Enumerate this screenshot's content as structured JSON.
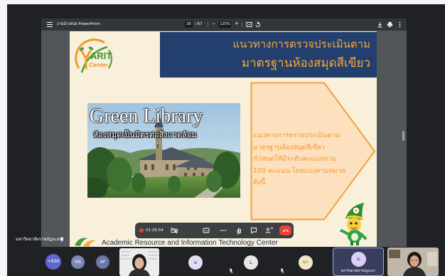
{
  "meeting": {
    "presenter_label": "มหาวิทยาลัยราชภัฏยะลา"
  },
  "pdf_viewer": {
    "title": "งานนำเสนอ PowerPoint",
    "page_current": "30",
    "page_total": "/ 67",
    "zoom_out": "—",
    "zoom": "125%",
    "zoom_in": "+",
    "icons": [
      "menu-icon",
      "fit-page-icon",
      "rotate-icon",
      "download-icon",
      "print-icon",
      "more-vert-icon"
    ]
  },
  "slide": {
    "logo": {
      "name": "ARIT",
      "sub": "Center"
    },
    "heading": [
      "แนวทางการตรวจประเมินตาม",
      "มาตรฐานห้องสมุดสีเขียว"
    ],
    "image_title": "Green Library",
    "image_subtitle": "ห้องสมุดเป็นมิตรต่อสิ่งแวดล้อม",
    "arrow_text": [
      "แนวทางการตรวจประเมินตาม",
      "มาตรฐานห้องสมุดสีเขียว",
      "กำหนดให้มีระดับคะแนนรวม",
      "100 คะแนน โดยแบ่งตามหมวด",
      "ดังนี้"
    ],
    "footer": "Academic Resource and Information Technology Center"
  },
  "call_controls": {
    "timer": "01:25:54",
    "icons": [
      "record-icon",
      "camera-off-icon",
      "captions-icon",
      "more-horiz-icon",
      "raise-hand-icon",
      "chat-icon",
      "participants-icon",
      "hang-up-icon"
    ]
  },
  "participants": [
    {
      "initials": "+836",
      "color": "#5f67d0",
      "text_color": "#ffffff"
    },
    {
      "initials": "KN",
      "color": "#7a88b3",
      "text_color": "#ffffff"
    },
    {
      "initials": "AP",
      "color": "#6a77a8",
      "text_color": "#ffffff"
    },
    {
      "initials": "ม",
      "color": "#e4dcf5",
      "text_color": "#3c3f86"
    },
    {
      "initials": "L",
      "color": "#e8e8e8",
      "text_color": "#3c4043"
    },
    {
      "initials": "มา",
      "color": "#f3e6c2",
      "text_color": "#6b5316"
    }
  ],
  "active_speaker": {
    "initials": "ม",
    "name": "มหาวิทยาลัยราชภัฏยะลา",
    "color": "#d9d0f5",
    "text_color": "#3c3f86"
  },
  "colors": {
    "slide_bg": "#f8f0da",
    "heading_bg": "#233f6e",
    "heading_text": "#f6a73c",
    "arrow_fill": "#fde0bd",
    "arrow_stroke": "#f2a23c",
    "arrow_text": "#f29b33",
    "hangup": "#ea4335"
  }
}
